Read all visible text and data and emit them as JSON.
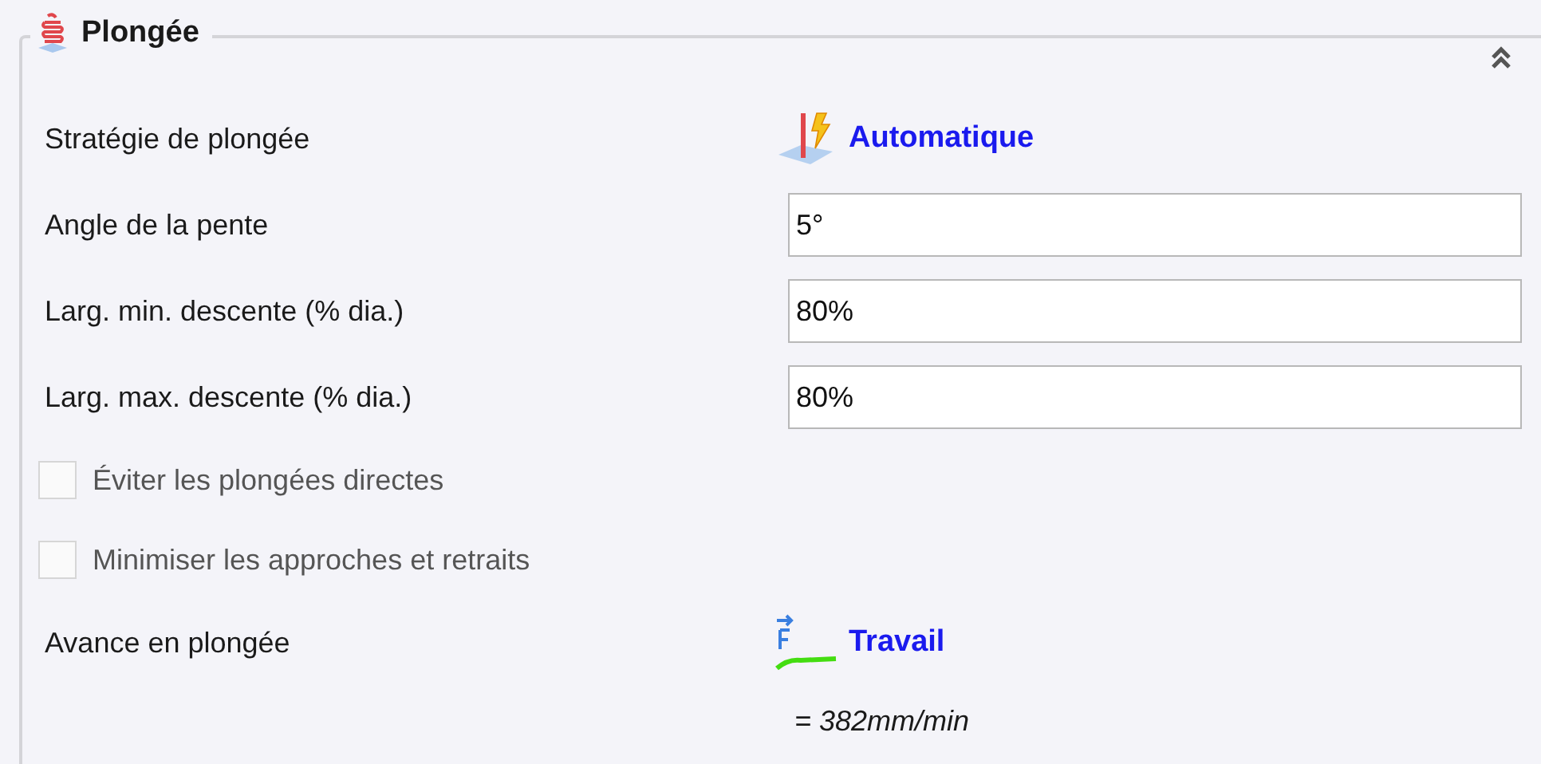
{
  "group": {
    "title": "Plongée"
  },
  "rows": [
    {
      "kind": "strategy",
      "label": "Stratégie de plongée",
      "value": "Automatique"
    },
    {
      "kind": "field",
      "label": "Angle de la pente",
      "value": "5°"
    },
    {
      "kind": "field",
      "label": "Larg. min. descente (% dia.)",
      "value": "80%"
    },
    {
      "kind": "field",
      "label": "Larg. max. descente (% dia.)",
      "value": "80%"
    },
    {
      "kind": "check",
      "label": "Éviter les plongées directes",
      "checked": false,
      "disabled": true
    },
    {
      "kind": "check",
      "label": "Minimiser les approches et retraits",
      "checked": false,
      "disabled": true
    },
    {
      "kind": "feed",
      "label": "Avance en plongée",
      "value": "Travail",
      "note": "= 382mm/min"
    }
  ]
}
